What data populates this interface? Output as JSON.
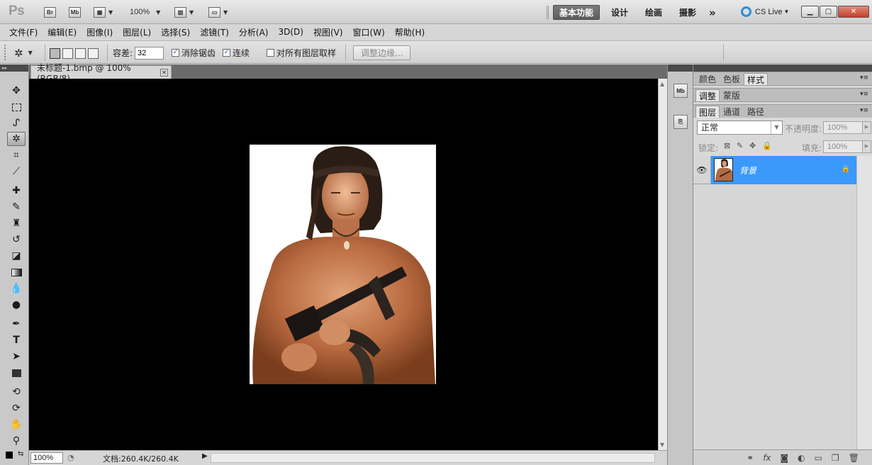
{
  "app": {
    "logo": "Ps",
    "bridge_label": "Br",
    "minibridge_label": "Mb",
    "zoom_select": "100%",
    "workspaces": [
      "基本功能",
      "设计",
      "绘画",
      "摄影"
    ],
    "more_label": "»",
    "cslive_label": "CS Live"
  },
  "menubar": {
    "items": [
      "文件(F)",
      "编辑(E)",
      "图像(I)",
      "图层(L)",
      "选择(S)",
      "滤镜(T)",
      "分析(A)",
      "3D(D)",
      "视图(V)",
      "窗口(W)",
      "帮助(H)"
    ]
  },
  "options": {
    "tolerance_label": "容差:",
    "tolerance_value": "32",
    "antialias_label": "消除锯齿",
    "antialias_checked": true,
    "contiguous_label": "连续",
    "contiguous_checked": true,
    "sample_all_label": "对所有图层取样",
    "sample_all_checked": false,
    "refine_edge_label": "调整边缘..."
  },
  "tools": [
    "move",
    "rectangular-marquee",
    "lasso",
    "magic-wand",
    "crop",
    "eyedropper",
    "spot-healing-brush",
    "brush",
    "clone-stamp",
    "history-brush",
    "eraser",
    "gradient",
    "blur",
    "dodge",
    "pen",
    "type",
    "path-selection",
    "rectangle-shape",
    "3d-rotate",
    "3d-orbit",
    "hand",
    "zoom"
  ],
  "document": {
    "tab_title": "未标题-1.bmp @ 100%(RGB/8)",
    "status_zoom": "100%",
    "status_doc": "文档:260.4K/260.4K"
  },
  "panels": {
    "group1_tabs": [
      "颜色",
      "色板",
      "样式"
    ],
    "group1_active": 2,
    "group2_tabs": [
      "调整",
      "蒙版"
    ],
    "group3_tabs": [
      "图层",
      "通道",
      "路径"
    ],
    "blend_mode": "正常",
    "opacity_label": "不透明度:",
    "opacity_value": "100%",
    "lock_label": "锁定:",
    "fill_label": "填充:",
    "fill_value": "100%",
    "layer_name": "背景"
  },
  "colors": {
    "accent": "#3b99fc",
    "canvas": "#000000",
    "panel_bg": "#d6d6d6"
  }
}
